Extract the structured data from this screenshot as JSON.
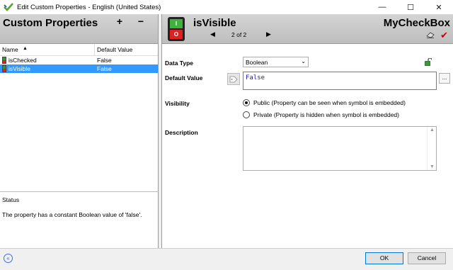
{
  "window": {
    "title": "Edit Custom Properties - English (United States)",
    "minimize": "—",
    "maximize": "☐",
    "close": "✕"
  },
  "left": {
    "title": "Custom Properties",
    "add_label": "+",
    "remove_label": "−",
    "columns": {
      "name": "Name",
      "sort_arrow": "▲",
      "default_value": "Default Value"
    },
    "rows": [
      {
        "name": "isChecked",
        "value": "False",
        "selected": false
      },
      {
        "name": "isVisible",
        "value": "False",
        "selected": true
      }
    ],
    "status_label": "Status",
    "status_text": "The property has a constant Boolean value of 'false'."
  },
  "right": {
    "property_name": "isVisible",
    "switch_on": "I",
    "switch_off": "O",
    "nav_prev": "◀",
    "nav_count": "2 of 2",
    "nav_next": "▶",
    "symbol_name": "MyCheckBox",
    "check": "✔",
    "data_type_label": "Data Type",
    "data_type_value": "Boolean",
    "chevron": "⌄",
    "default_value_label": "Default Value",
    "default_value": "False",
    "ellipsis": "...",
    "visibility_label": "Visibility",
    "visibility_options": [
      {
        "label": "Public (Property can be seen when symbol is embedded)",
        "checked": true
      },
      {
        "label": "Private (Property is hidden when symbol is embedded)",
        "checked": false
      }
    ],
    "description_label": "Description",
    "scroll_up": "▲",
    "scroll_down": "▼"
  },
  "footer": {
    "collapse": "«",
    "ok": "OK",
    "cancel": "Cancel"
  },
  "colors": {
    "selection": "#3399ff",
    "switch_green": "#3db33d",
    "switch_red": "#e02020",
    "check_red": "#cc0000",
    "accent_blue": "#0078d7"
  }
}
